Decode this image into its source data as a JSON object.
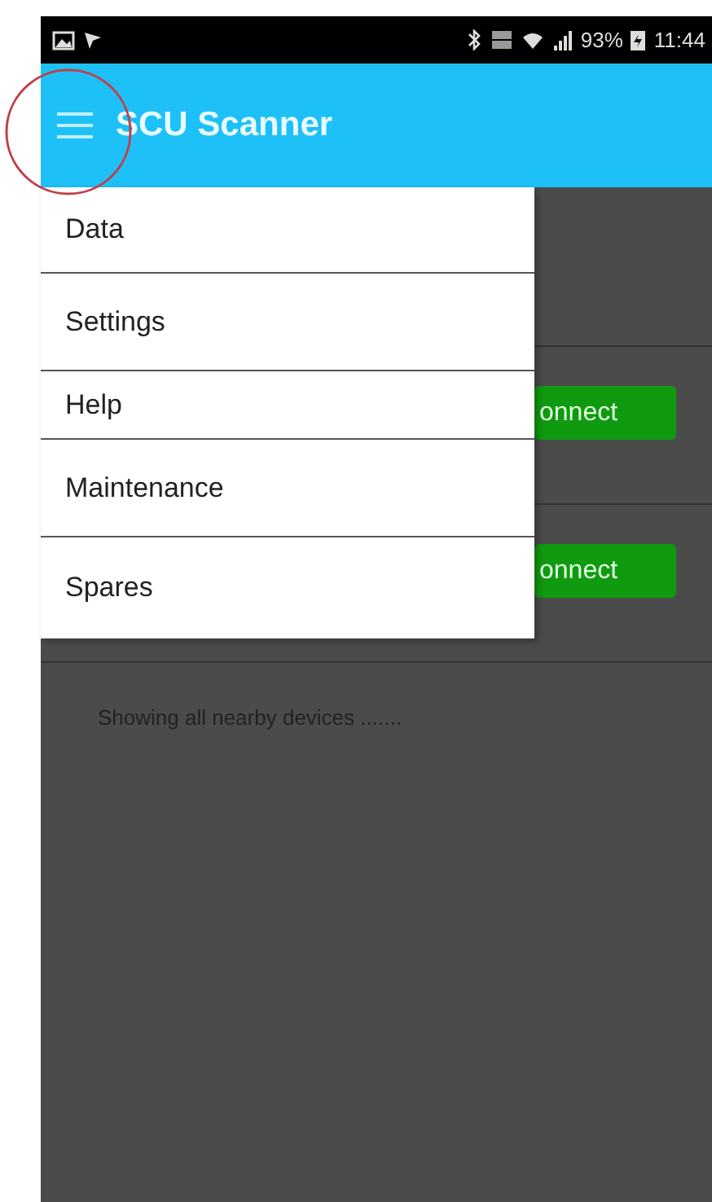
{
  "status_bar": {
    "battery": "93%",
    "time": "11:44"
  },
  "app_bar": {
    "title": "SCU Scanner"
  },
  "devices": [
    {
      "button": "onnect"
    },
    {
      "button": "onnect"
    }
  ],
  "status_message": "Showing all nearby devices .......",
  "menu": {
    "items": [
      "Data",
      "Settings",
      "Help",
      "Maintenance",
      "Spares"
    ]
  }
}
